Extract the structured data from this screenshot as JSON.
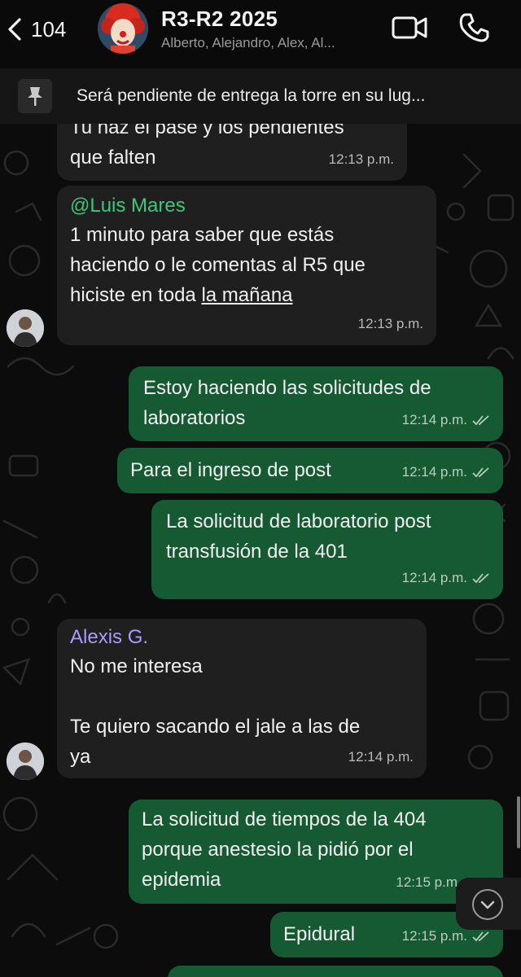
{
  "header": {
    "back_count": "104",
    "title": "R3-R2 2025",
    "subtitle": "Alberto, Alejandro, Alex, Al..."
  },
  "pinned": {
    "text": "Será pendiente de entrega la torre en su lug..."
  },
  "messages": [
    {
      "direction": "in",
      "lines": [
        "Tu haz el pase y los pendientes",
        "que falten"
      ],
      "time": "12:13 p.m."
    },
    {
      "direction": "in",
      "sender": "@Luis Mares",
      "lines": [
        "1 minuto para saber que estás",
        "haciendo o le comentas al R5 que",
        "hiciste en toda "
      ],
      "underlined": "la mañana",
      "time": "12:13 p.m."
    },
    {
      "direction": "out",
      "lines": [
        "Estoy haciendo las solicitudes de",
        "laboratorios"
      ],
      "time": "12:14 p.m."
    },
    {
      "direction": "out",
      "lines": [
        "Para el ingreso de post"
      ],
      "time": "12:14 p.m."
    },
    {
      "direction": "out",
      "lines": [
        "La solicitud de laboratorio post",
        "transfusión de la 401"
      ],
      "time": "12:14 p.m."
    },
    {
      "direction": "in",
      "sender": "Alexis G.",
      "lines": [
        "No me interesa",
        "",
        "Te quiero sacando el jale a las de",
        "ya"
      ],
      "time": "12:14 p.m."
    },
    {
      "direction": "out",
      "lines": [
        "La solicitud de tiempos de la 404",
        "porque anestesio la pidió por el",
        "epidemia"
      ],
      "time": "12:15 p.m"
    },
    {
      "direction": "out",
      "lines": [
        "Epidural"
      ],
      "time": "12:15 p.m."
    }
  ],
  "icons": {
    "back": "chevron-left-icon",
    "video": "video-camera-icon",
    "call": "phone-icon",
    "pin": "pin-icon",
    "read": "double-check-icon",
    "scroll": "chevron-down-icon"
  },
  "colors": {
    "outgoing_bubble": "#165a33",
    "incoming_bubble": "#1f1f1f",
    "mention": "#3ec77a",
    "sender_alexis": "#a99bff"
  }
}
